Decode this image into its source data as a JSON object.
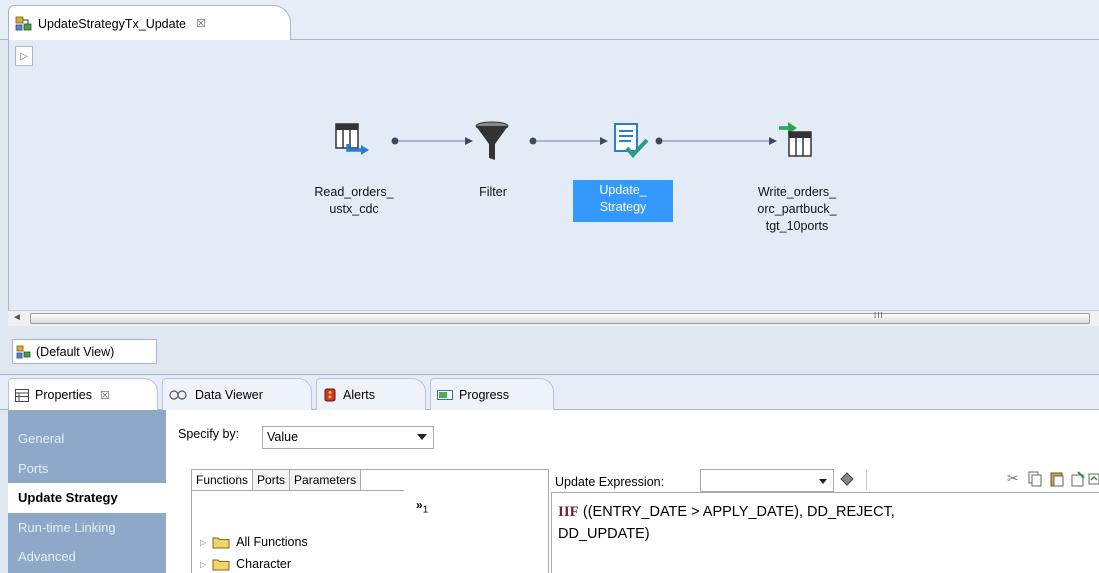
{
  "editor_tab": {
    "title": "UpdateStrategyTx_Update",
    "close": "☒"
  },
  "canvas": {
    "play": "▷",
    "nodes": [
      {
        "label_line1": "Read_orders_",
        "label_line2": "ustx_cdc",
        "label_line3": ""
      },
      {
        "label_line1": "Filter",
        "label_line2": "",
        "label_line3": ""
      },
      {
        "label_line1": "Update_",
        "label_line2": "Strategy",
        "label_line3": ""
      },
      {
        "label_line1": "Write_orders_",
        "label_line2": "orc_partbuck_",
        "label_line3": "tgt_10ports"
      }
    ]
  },
  "scrollbar": {
    "left_arrow": "◄",
    "grip": "III"
  },
  "view_tab": {
    "label": "(Default View)"
  },
  "bottom_tabs": [
    {
      "label": "Properties",
      "close": "☒"
    },
    {
      "label": "Data Viewer"
    },
    {
      "label": "Alerts"
    },
    {
      "label": "Progress"
    }
  ],
  "sidebar": {
    "items": [
      "General",
      "Ports",
      "Update Strategy",
      "Run-time Linking",
      "Advanced"
    ]
  },
  "specify": {
    "label": "Specify by:",
    "value": "Value"
  },
  "functions": {
    "tabs": [
      "Functions",
      "Ports",
      "Parameters"
    ],
    "extra": "»",
    "extra_sub": "1",
    "tree": [
      "All Functions",
      "Character"
    ]
  },
  "expression": {
    "label": "Update Expression:",
    "keyword": "IIF",
    "line1_rest": " ((ENTRY_DATE > APPLY_DATE), DD_REJECT,",
    "line2": "DD_UPDATE)"
  },
  "colors": {
    "selection": "#3399ff",
    "sidebar": "#8ea8c8",
    "keyword": "#7a1a40"
  }
}
